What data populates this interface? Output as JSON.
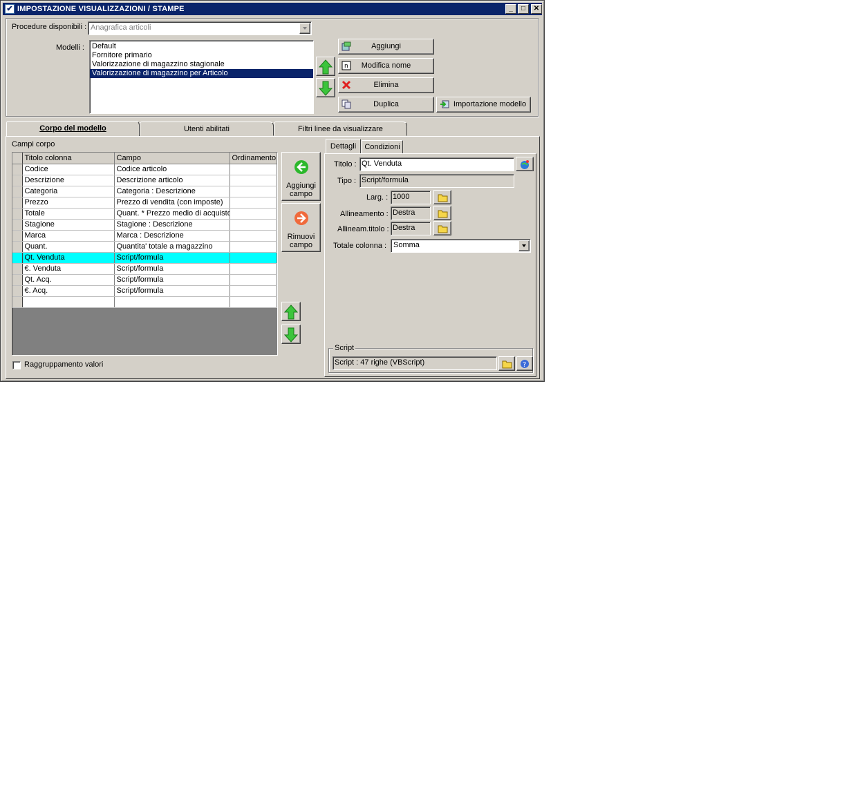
{
  "window": {
    "title": "IMPOSTAZIONE VISUALIZZAZIONI / STAMPE",
    "min": "_",
    "max": "□",
    "close": "✕"
  },
  "top": {
    "procedure_label": "Procedure disponibili :",
    "procedure_value": "Anagrafica articoli",
    "modelli_label": "Modelli :",
    "modelli": [
      "Default",
      "Fornitore primario",
      "Valorizzazione di magazzino stagionale",
      "Valorizzazione di magazzino per Articolo"
    ],
    "selected_index": 3,
    "buttons": {
      "aggiungi": "Aggiungi",
      "modifica_nome": "Modifica nome",
      "elimina": "Elimina",
      "duplica": "Duplica",
      "importazione": "Importazione modello"
    }
  },
  "tabs": [
    {
      "label": "Corpo del modello",
      "active": true
    },
    {
      "label": "Utenti abilitati",
      "active": false
    },
    {
      "label": "Filtri linee da visualizzare",
      "active": false
    }
  ],
  "body": {
    "campi_label": "Campi corpo",
    "columns": [
      "Titolo colonna",
      "Campo",
      "Ordinamento"
    ],
    "rows": [
      [
        "Codice",
        "Codice articolo",
        ""
      ],
      [
        "Descrizione",
        "Descrizione articolo",
        ""
      ],
      [
        "Categoria",
        "Categoria : Descrizione",
        ""
      ],
      [
        "Prezzo",
        "Prezzo di vendita (con imposte)",
        ""
      ],
      [
        "Totale",
        "Quant. * Prezzo medio di acquisto",
        ""
      ],
      [
        "Stagione",
        "Stagione : Descrizione",
        ""
      ],
      [
        "Marca",
        "Marca : Descrizione",
        ""
      ],
      [
        "Quant.",
        "Quantita' totale a magazzino",
        ""
      ],
      [
        "Qt. Venduta",
        "Script/formula",
        ""
      ],
      [
        "€. Venduta",
        "Script/formula",
        ""
      ],
      [
        "Qt. Acq.",
        "Script/formula",
        ""
      ],
      [
        "€. Acq.",
        "Script/formula",
        ""
      ],
      [
        "",
        "",
        ""
      ]
    ],
    "selected_row": 8,
    "aggiungi_campo": [
      "Aggiungi",
      "campo"
    ],
    "rimuovi_campo": [
      "Rimuovi",
      "campo"
    ],
    "raggruppamento_label": "Raggruppamento valori",
    "raggruppamento_checked": false
  },
  "details": {
    "tabs": [
      "Dettagli",
      "Condizioni"
    ],
    "titolo_label": "Titolo :",
    "titolo_value": "Qt. Venduta",
    "tipo_label": "Tipo :",
    "tipo_value": "Script/formula",
    "larg_label": "Larg. :",
    "larg_value": "1000",
    "allineamento_label": "Allineamento :",
    "allineamento_value": "Destra",
    "allineam_titolo_label": "Allineam.titolo :",
    "allineam_titolo_value": "Destra",
    "totale_label": "Totale colonna :",
    "totale_value": "Somma",
    "script_group": "Script",
    "script_value": "Script : 47 righe (VBScript)"
  },
  "colors": {
    "title_bar": "#0a246a",
    "face": "#d4d0c8",
    "selected_row": "#00ffff",
    "grid_empty": "#808080"
  }
}
